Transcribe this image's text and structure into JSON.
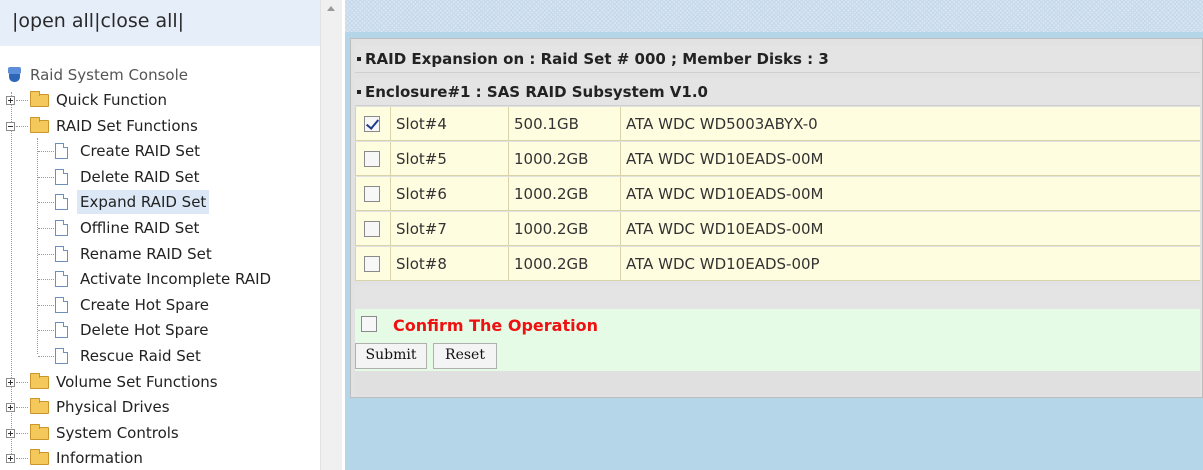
{
  "tree_header": {
    "open_all": "open all",
    "close_all": "close all",
    "separator": "|"
  },
  "tree": {
    "root_label": "Raid System Console",
    "items": [
      {
        "label": "Quick Function",
        "type": "folder",
        "state": "collapsed"
      },
      {
        "label": "RAID Set Functions",
        "type": "folder",
        "state": "expanded"
      },
      {
        "label": "Create RAID Set",
        "type": "page"
      },
      {
        "label": "Delete RAID Set",
        "type": "page"
      },
      {
        "label": "Expand RAID Set",
        "type": "page",
        "selected": true
      },
      {
        "label": "Offline RAID Set",
        "type": "page"
      },
      {
        "label": "Rename RAID Set",
        "type": "page"
      },
      {
        "label": "Activate Incomplete RAID",
        "type": "page"
      },
      {
        "label": "Create Hot Spare",
        "type": "page"
      },
      {
        "label": "Delete Hot Spare",
        "type": "page"
      },
      {
        "label": "Rescue Raid Set",
        "type": "page"
      },
      {
        "label": "Volume Set Functions",
        "type": "folder",
        "state": "collapsed"
      },
      {
        "label": "Physical Drives",
        "type": "folder",
        "state": "collapsed"
      },
      {
        "label": "System Controls",
        "type": "folder",
        "state": "collapsed"
      },
      {
        "label": "Information",
        "type": "folder",
        "state": "collapsed"
      }
    ]
  },
  "main": {
    "title": "RAID Expansion on : Raid Set # 000 ; Member Disks : 3",
    "enclosure": "Enclosure#1 : SAS RAID Subsystem V1.0",
    "disks": [
      {
        "slot": "Slot#4",
        "capacity": "500.1GB",
        "model": "ATA WDC WD5003ABYX-0",
        "checked": true
      },
      {
        "slot": "Slot#5",
        "capacity": "1000.2GB",
        "model": "ATA WDC WD10EADS-00M",
        "checked": false
      },
      {
        "slot": "Slot#6",
        "capacity": "1000.2GB",
        "model": "ATA WDC WD10EADS-00M",
        "checked": false
      },
      {
        "slot": "Slot#7",
        "capacity": "1000.2GB",
        "model": "ATA WDC WD10EADS-00M",
        "checked": false
      },
      {
        "slot": "Slot#8",
        "capacity": "1000.2GB",
        "model": "ATA WDC WD10EADS-00P",
        "checked": false
      }
    ],
    "confirm_label": "Confirm The Operation",
    "confirm_checked": false,
    "submit_label": "Submit",
    "reset_label": "Reset"
  },
  "colors": {
    "confirm_text": "#ee1111",
    "row_background": "#fffde0",
    "confirm_background": "#e6fbe6",
    "content_background": "#b5d6e8"
  }
}
